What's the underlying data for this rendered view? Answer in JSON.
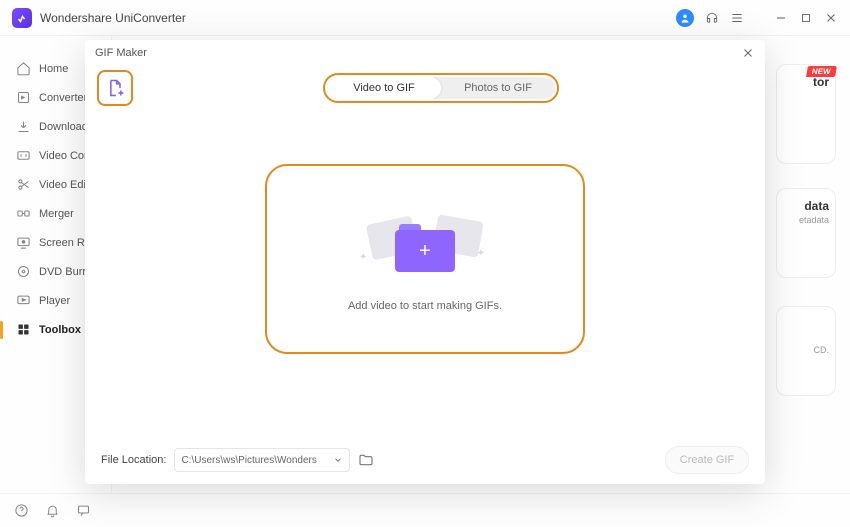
{
  "app": {
    "title": "Wondershare UniConverter"
  },
  "sidebar": {
    "items": [
      {
        "label": "Home"
      },
      {
        "label": "Converter"
      },
      {
        "label": "Downloader"
      },
      {
        "label": "Video Compressor"
      },
      {
        "label": "Video Editor"
      },
      {
        "label": "Merger"
      },
      {
        "label": "Screen Recorder"
      },
      {
        "label": "DVD Burner"
      },
      {
        "label": "Player"
      },
      {
        "label": "Toolbox"
      }
    ]
  },
  "badges": {
    "new": "NEW"
  },
  "cards": {
    "c1": {
      "title": "tor",
      "sub": ""
    },
    "c2": {
      "title": "data",
      "sub": "etadata"
    },
    "c3": {
      "title": "",
      "sub": "CD."
    }
  },
  "modal": {
    "title": "GIF Maker",
    "seg": {
      "a": "Video to GIF",
      "b": "Photos to GIF"
    },
    "drop_msg": "Add video to start making GIFs.",
    "footer": {
      "label": "File Location:",
      "path": "C:\\Users\\ws\\Pictures\\Wonders",
      "create": "Create GIF"
    }
  }
}
